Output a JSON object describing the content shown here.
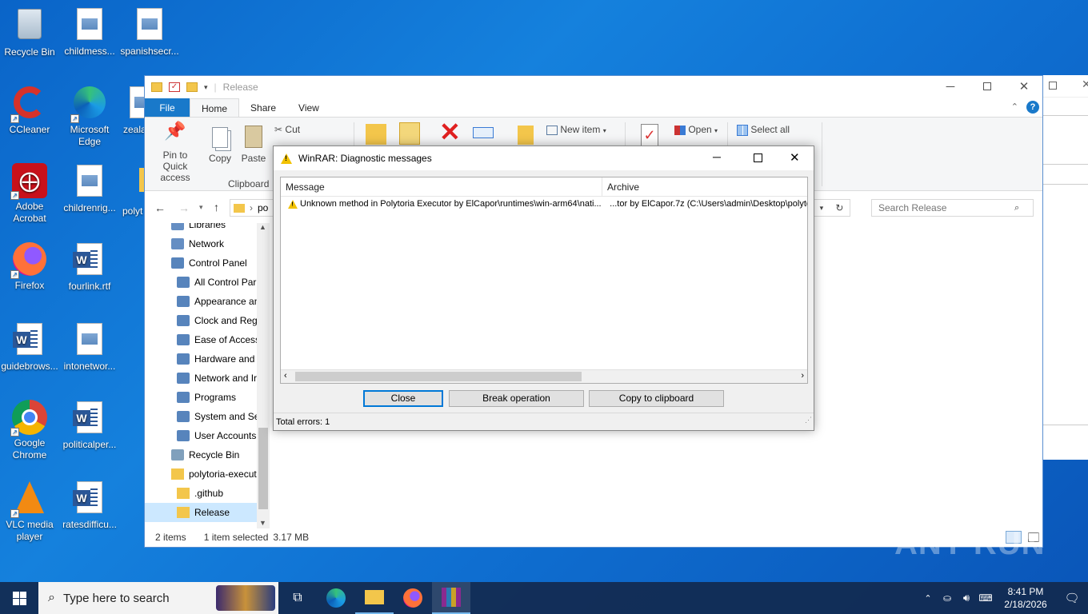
{
  "desktop": {
    "icons": [
      {
        "label": "Recycle Bin",
        "line2": ""
      },
      {
        "label": "childmess...",
        "line2": ""
      },
      {
        "label": "spanishsecr...",
        "line2": ""
      },
      {
        "label": "CCleaner",
        "line2": ""
      },
      {
        "label": "Microsoft",
        "line2": "Edge"
      },
      {
        "label": "zeala",
        "line2": ""
      },
      {
        "label": "Adobe",
        "line2": "Acrobat"
      },
      {
        "label": "childrenrig...",
        "line2": ""
      },
      {
        "label": "polyt",
        "line2": ""
      },
      {
        "label": "Firefox",
        "line2": ""
      },
      {
        "label": "fourlink.rtf",
        "line2": ""
      },
      {
        "label": "guidebrows...",
        "line2": ""
      },
      {
        "label": "intonetwor...",
        "line2": ""
      },
      {
        "label": "Google",
        "line2": "Chrome"
      },
      {
        "label": "politicalper...",
        "line2": ""
      },
      {
        "label": "VLC media",
        "line2": "player"
      },
      {
        "label": "ratesdifficu...",
        "line2": ""
      }
    ]
  },
  "explorer": {
    "title": "Release",
    "tabs": [
      "File",
      "Home",
      "Share",
      "View"
    ],
    "ribbon": {
      "pin": "Pin to Quick access",
      "copy": "Copy",
      "paste": "Paste",
      "cut": "Cut",
      "clipboard": "Clipboard",
      "new_item": "New item",
      "open": "Open",
      "select_all": "Select all"
    },
    "address_prefix": "po",
    "search_placeholder": "Search Release",
    "nav": [
      {
        "label": "Libraries",
        "indent": 0
      },
      {
        "label": "Network",
        "indent": 0
      },
      {
        "label": "Control Panel",
        "indent": 0
      },
      {
        "label": "All Control Par",
        "indent": 1
      },
      {
        "label": "Appearance an",
        "indent": 1
      },
      {
        "label": "Clock and Regi",
        "indent": 1
      },
      {
        "label": "Ease of Access",
        "indent": 1
      },
      {
        "label": "Hardware and",
        "indent": 1
      },
      {
        "label": "Network and Ir",
        "indent": 1
      },
      {
        "label": "Programs",
        "indent": 1
      },
      {
        "label": "System and Sec",
        "indent": 1
      },
      {
        "label": "User Accounts",
        "indent": 1
      },
      {
        "label": "Recycle Bin",
        "indent": 0
      },
      {
        "label": "polytoria-execut",
        "indent": 0
      },
      {
        "label": ".github",
        "indent": 1
      },
      {
        "label": "Release",
        "indent": 1
      }
    ],
    "status": {
      "items": "2 items",
      "selected": "1 item selected",
      "size": "3.17 MB"
    }
  },
  "dialog": {
    "title": "WinRAR: Diagnostic messages",
    "columns": [
      "Message",
      "Archive"
    ],
    "rows": [
      {
        "message": "Unknown method in Polytoria Executor by ElCapor\\runtimes\\win-arm64\\nati...",
        "archive": "...tor by ElCapor.7z (C:\\Users\\admin\\Desktop\\polyto"
      }
    ],
    "buttons": {
      "close": "Close",
      "break": "Break operation",
      "copy": "Copy to clipboard"
    },
    "total": "Total errors: 1"
  },
  "taskbar": {
    "search_placeholder": "Type here to search",
    "time": "8:41 PM",
    "date": "2/18/2026"
  },
  "watermark": "ANY RUN"
}
